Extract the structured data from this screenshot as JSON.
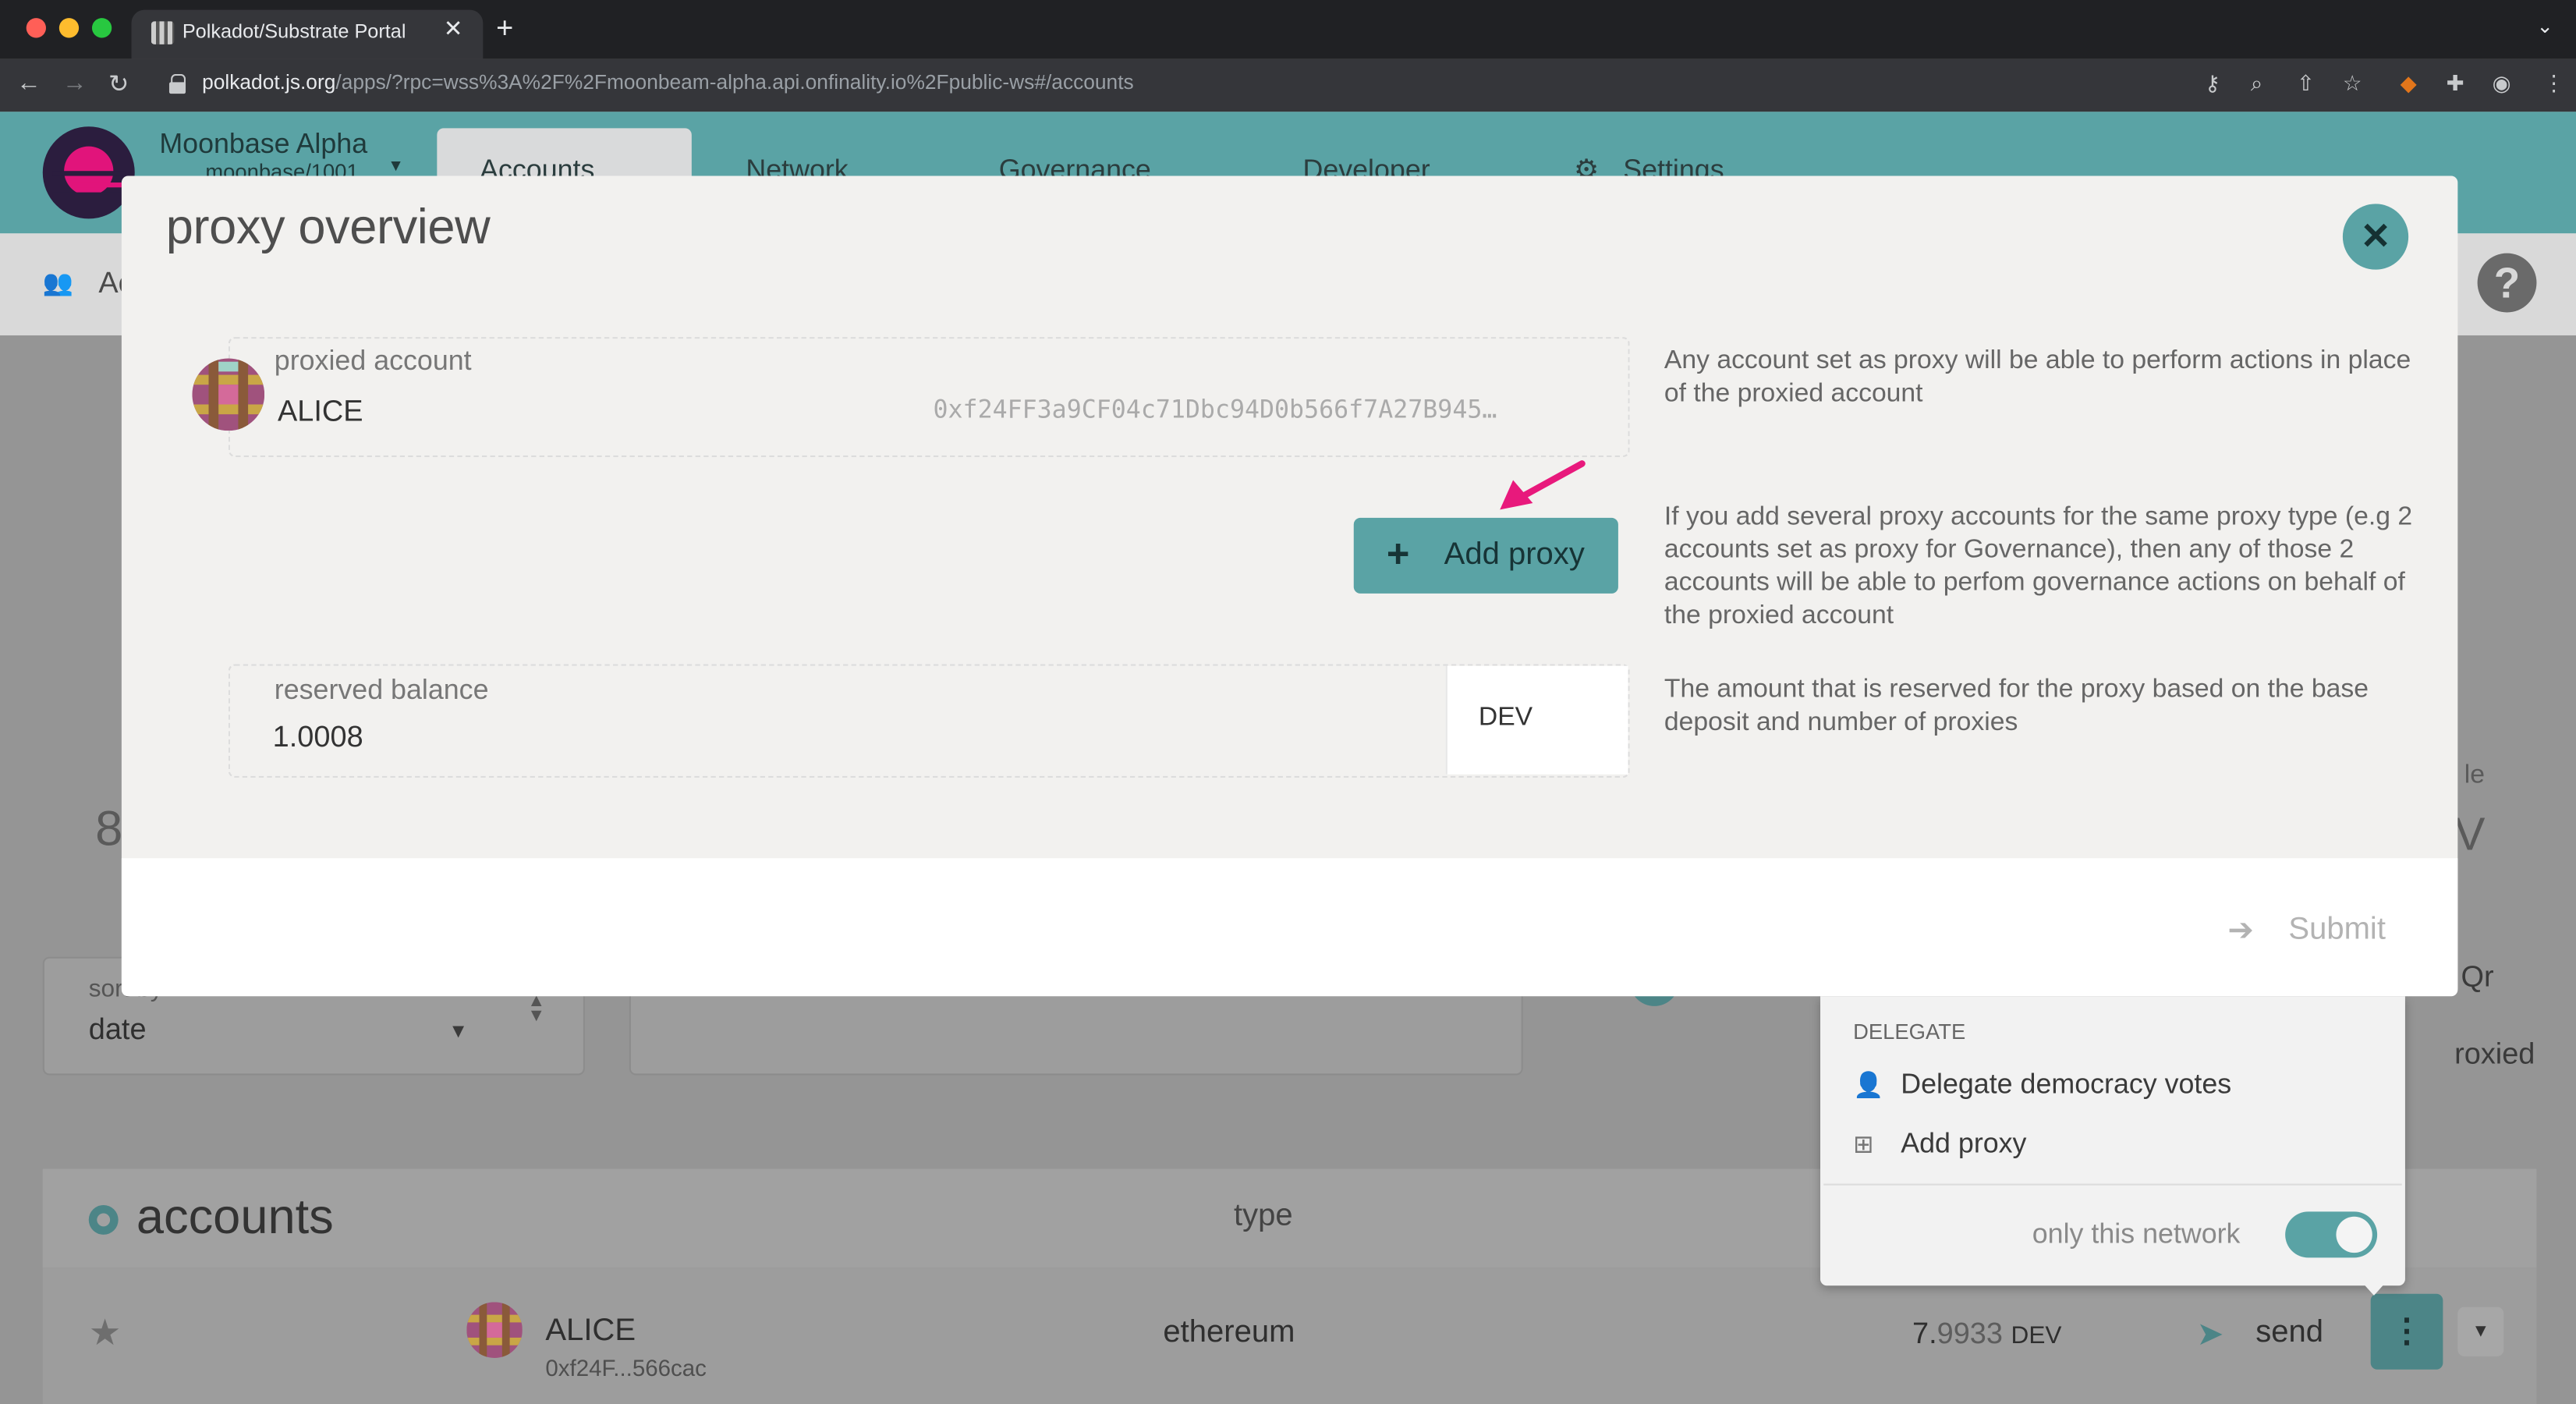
{
  "browser": {
    "tab_title": "Polkadot/Substrate Portal",
    "url_domain": "polkadot.js.org",
    "url_path": "/apps/?rpc=wss%3A%2F%2Fmoonbeam-alpha.api.onfinality.io%2Fpublic-ws#/accounts"
  },
  "app": {
    "chain_name": "Moonbase Alpha",
    "chain_sub": "moonbase/1001",
    "nav": [
      "Accounts",
      "Network",
      "Governance",
      "Developer",
      "Settings"
    ],
    "subnav_first": "Ac"
  },
  "background": {
    "big_number": "8",
    "right_label_fragment": "le",
    "right_value_fragment": "V",
    "sort": {
      "label": "sort by",
      "value": "date"
    },
    "qr_fragment": "Qr",
    "proxied_fragment": "roxied",
    "accounts_title": "accounts",
    "type_header": "type",
    "row": {
      "name": "ALICE",
      "address": "0xf24F...566cac",
      "type": "ethereum",
      "balance_whole": "7.",
      "balance_fraction": "9933",
      "balance_unit": "DEV",
      "send_label": "send"
    }
  },
  "popup_menu": {
    "section": "DELEGATE",
    "items": [
      "Delegate democracy votes",
      "Add proxy"
    ],
    "toggle_label": "only this network",
    "toggle_on": true
  },
  "modal": {
    "title": "proxy overview",
    "proxied_label": "proxied account",
    "proxied_name": "ALICE",
    "proxied_address": "0xf24FF3a9CF04c71Dbc94D0b566f7A27B945…",
    "proxied_help": "Any account set as proxy will be able to perform actions in place of the proxied account",
    "add_proxy_label": "Add proxy",
    "add_proxy_help": "If you add several proxy accounts for the same proxy type (e.g 2 accounts set as proxy for Governance), then any of those 2 accounts will be able to perfom governance actions on behalf of the proxied account",
    "reserved_label": "reserved balance",
    "reserved_value": "1.0008",
    "reserved_unit": "DEV",
    "reserved_help": "The amount that is reserved for the proxy based on the base deposit and number of proxies",
    "submit_label": "Submit"
  },
  "icons": {
    "close": "close-icon",
    "plus": "plus-icon",
    "submit": "sign-in-icon",
    "annotation": "pink-arrow-icon"
  },
  "colors": {
    "accent": "#5aa3a5",
    "annotation": "#e8197c"
  }
}
